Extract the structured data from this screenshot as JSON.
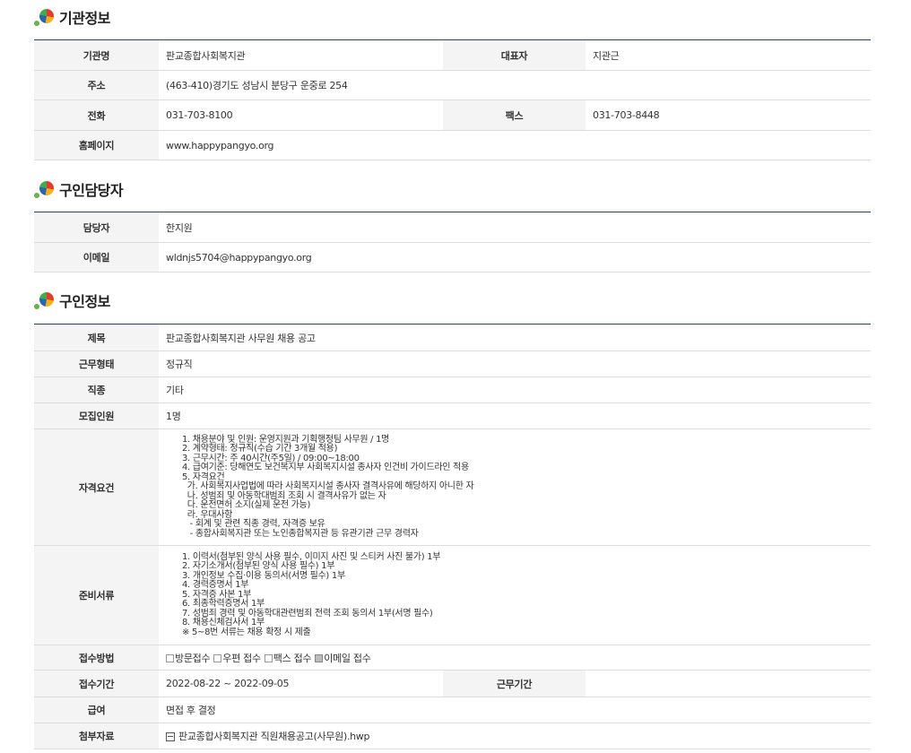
{
  "org_section": {
    "title": "기관정보",
    "name_label": "기관명",
    "name": "판교종합사회복지관",
    "rep_label": "대표자",
    "rep": "지관근",
    "addr_label": "주소",
    "addr": "(463-410)경기도 성남시 분당구 운중로 254",
    "tel_label": "전화",
    "tel": "031-703-8100",
    "fax_label": "팩스",
    "fax": "031-703-8448",
    "web_label": "홈페이지",
    "web": "www.happypangyo.org"
  },
  "contact_section": {
    "title": "구인담당자",
    "person_label": "담당자",
    "person": "한지원",
    "email_label": "이메일",
    "email": "wldnjs5704@happypangyo.org"
  },
  "job_section": {
    "title": "구인정보",
    "subject_label": "제목",
    "subject": "판교종합사회복지관 사무원 채용 공고",
    "type_label": "근무형태",
    "type": "정규직",
    "category_label": "직종",
    "category": "기타",
    "count_label": "모집인원",
    "count": "1명",
    "qual_label": "자격요건",
    "qual_lines": [
      "1. 채용분야 및 인원: 운영지원과 기획행정팀 사무원 / 1명",
      "2. 계약형태: 정규직(수습 기간 3개월 적용)",
      "3. 근무시간: 주 40시간(주5일) / 09:00~18:00",
      "4. 급여기준: 당해연도 보건복지부 사회복지시설 종사자 인건비 가이드라인 적용",
      "5. 자격요건",
      "  가. 사회복지사업법에 따라 사회복지시설 종사자 결격사유에 해당하지 아니한 자",
      "  나. 성범죄 및 아동학대범죄 조회 시 결격사유가 없는 자",
      "  다. 운전면허 소지(실제 운전 가능)",
      "  라. 우대사항",
      "   - 회계 및 관련 직종 경력, 자격증 보유",
      "   - 종합사회복지관 또는 노인종합복지관 등 유관기관 근무 경력자"
    ],
    "docs_label": "준비서류",
    "docs_lines": [
      "1. 이력서(첨부된 양식 사용 필수, 이미지 사진 및 스티커 사진 불가) 1부",
      "2. 자기소개서(첨부된 양식 사용 필수) 1부",
      "3. 개인정보 수집·이용 동의서(서명 필수) 1부",
      "4. 경력증명서 1부",
      "5. 자격증 사본 1부",
      "6. 최종학력증명서 1부",
      "7. 성범죄 경력 및 아동학대관련범죄 전력 조회 동의서 1부(서명 필수)",
      "8. 채용신체검사서 1부",
      "※ 5~8번 서류는 채용 확정 시 제출"
    ],
    "method_label": "접수방법",
    "methods": [
      {
        "label": "방문접수",
        "checked": false
      },
      {
        "label": "우편 접수",
        "checked": false
      },
      {
        "label": "팩스 접수",
        "checked": false
      },
      {
        "label": "이메일 접수",
        "checked": true
      }
    ],
    "period_label": "접수기간",
    "period": "2022-08-22 ~ 2022-09-05",
    "work_period_label": "근무기간",
    "work_period": "",
    "salary_label": "급여",
    "salary": "면접 후 결정",
    "attach_label": "첨부자료",
    "attach": "판교종합사회복지관 직원채용공고(사무원).hwp"
  }
}
